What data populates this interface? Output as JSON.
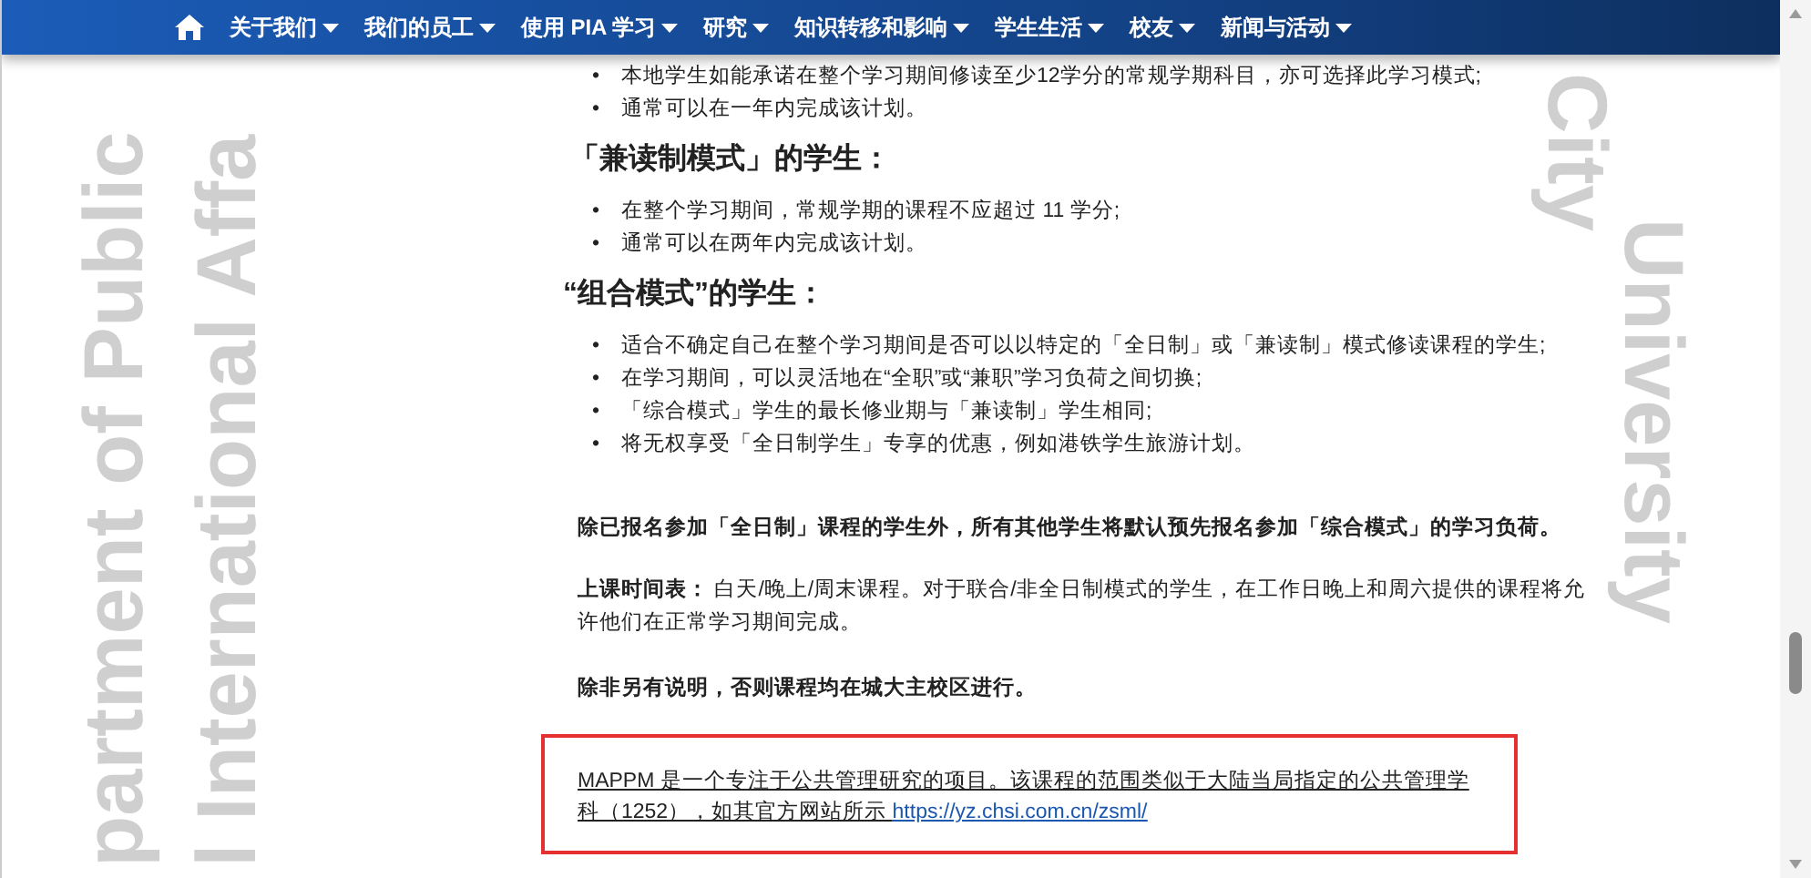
{
  "nav": {
    "items": [
      {
        "label": "关于我们"
      },
      {
        "label": "我们的员工"
      },
      {
        "label": "使用 PIA 学习"
      },
      {
        "label": "研究"
      },
      {
        "label": "知识转移和影响"
      },
      {
        "label": "学生生活"
      },
      {
        "label": "校友"
      },
      {
        "label": "新闻与活动"
      }
    ]
  },
  "background_text": [
    "partment of Public",
    "l International Affa",
    "City",
    "University"
  ],
  "content": [
    {
      "kind": "list",
      "marker": "•",
      "items": [
        "本地学生如能承诺在整个学习期间修读至少12学分的常规学期科目，亦可选择此学习模式;",
        "通常可以在一年内完成该计划。"
      ]
    },
    {
      "kind": "heading",
      "text": "「兼读制模式」的学生："
    },
    {
      "kind": "list",
      "marker": "•",
      "items": [
        "在整个学习期间，常规学期的课程不应超过 11 学分;",
        "通常可以在两年内完成该计划。"
      ]
    },
    {
      "kind": "heading",
      "text": "“组合模式”的学生："
    },
    {
      "kind": "list",
      "marker": "•",
      "items": [
        "适合不确定自己在整个学习期间是否可以以特定的「全日制」或「兼读制」模式修读课程的学生;",
        "在学习期间，可以灵活地在“全职”或“兼职”学习负荷之间切换;",
        "「综合模式」学生的最长修业期与「兼读制」学生相同;",
        "将无权享受「全日制学生」专享的优惠，例如港铁学生旅游计划。"
      ]
    },
    {
      "kind": "bold",
      "text": "除已报名参加「全日制」课程的学生外，所有其他学生将默认预先报名参加「综合模式」的学习负荷。"
    },
    {
      "kind": "paragraph",
      "text": "**上课时间表：** 白天/晚上/周末课程。对于联合/非全日制模式的学生，在工作日晚上和周六提供的课程将允许他们在正常学习期间完成。"
    },
    {
      "kind": "bold",
      "text": "除非另有说明，否则课程均在城大主校区进行。"
    },
    {
      "kind": "notice",
      "text": "MAPPM 是一个专注于公共管理研究的项目。该课程的范围类似于大陆当局指定的公共管理学科（1252），如其官方网站所示 ",
      "link": "https://yz.chsi.com.cn/zsml/"
    }
  ]
}
